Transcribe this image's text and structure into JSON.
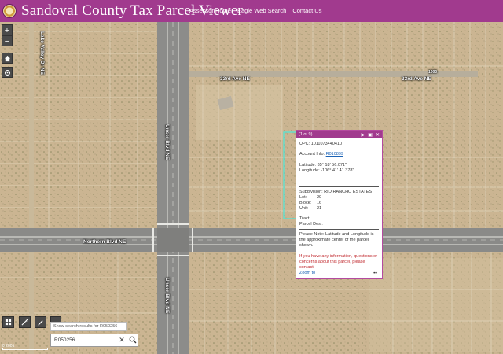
{
  "header": {
    "title": "Sandoval County Tax Parcel Viewer",
    "nav": [
      "Assessor Home",
      "Eagle Web Search",
      "Contact Us"
    ],
    "brand_color": "#a13a8e"
  },
  "map": {
    "road_labels": {
      "top_left": "Lake Valley Dr NE",
      "center_vertical_top": "Unser Blvd NE",
      "center_vertical_bottom": "Unser Blvd NE",
      "avenue_33rd_left": "33rd Ave NE",
      "avenue_33rd_right": "33rd Ave NE",
      "avenue_33rd_right_badge": "1990",
      "cross_road_left": "Northern Blvd NE"
    },
    "zoom_in": "+",
    "zoom_out": "−",
    "scale_label": "0 200ft"
  },
  "popup": {
    "pager": "(1 of 9)",
    "upc": "UPC: 1011073440410",
    "account_label": "Account Info: ",
    "account_value": "R010899",
    "latitude": "Latitude: 35° 18' 56.071\"",
    "longitude": "Longitude: -106° 41' 41.378\"",
    "subdivision": "Subdivision: RIO RANCHO ESTATES",
    "lot_label": "Lot:",
    "lot_value": "29",
    "block_label": "Block:",
    "block_value": "16",
    "unit_label": "Unit:",
    "unit_value": "21",
    "tract": "Tract:",
    "parcel_des": "Parcel Des.:",
    "note": "Please Note: Latitude and Longitude is the approximate center of the parcel shown.",
    "contact": "If you have any information, questions or concerns about this parcel, please contact",
    "zoom_to": "Zoom to",
    "menu": "•••"
  },
  "search": {
    "hint": "Show search results for R050256",
    "value": "R050256",
    "clear": "✕"
  }
}
